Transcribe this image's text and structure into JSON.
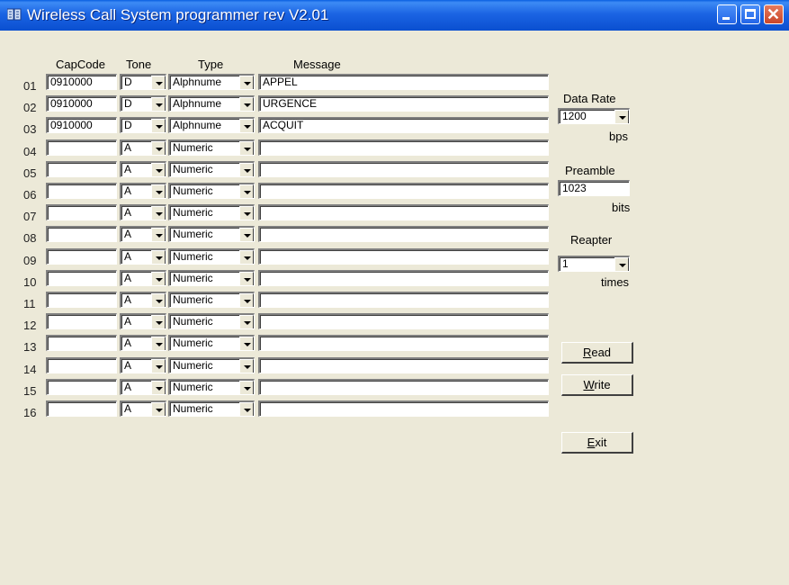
{
  "window": {
    "title": "Wireless Call System programmer rev  V2.01",
    "accent": "#1b64e3",
    "background": "#ece9d8"
  },
  "headers": {
    "capcode": "CapCode",
    "tone": "Tone",
    "type": "Type",
    "message": "Message"
  },
  "rows": [
    {
      "num": "01",
      "capcode": "0910000",
      "tone": "D",
      "type": "Alphnume",
      "message": "APPEL"
    },
    {
      "num": "02",
      "capcode": "0910000",
      "tone": "D",
      "type": "Alphnume",
      "message": "URGENCE"
    },
    {
      "num": "03",
      "capcode": "0910000",
      "tone": "D",
      "type": "Alphnume",
      "message": "ACQUIT"
    },
    {
      "num": "04",
      "capcode": "",
      "tone": "A",
      "type": "Numeric",
      "message": ""
    },
    {
      "num": "05",
      "capcode": "",
      "tone": "A",
      "type": "Numeric",
      "message": ""
    },
    {
      "num": "06",
      "capcode": "",
      "tone": "A",
      "type": "Numeric",
      "message": ""
    },
    {
      "num": "07",
      "capcode": "",
      "tone": "A",
      "type": "Numeric",
      "message": ""
    },
    {
      "num": "08",
      "capcode": "",
      "tone": "A",
      "type": "Numeric",
      "message": ""
    },
    {
      "num": "09",
      "capcode": "",
      "tone": "A",
      "type": "Numeric",
      "message": ""
    },
    {
      "num": "10",
      "capcode": "",
      "tone": "A",
      "type": "Numeric",
      "message": ""
    },
    {
      "num": "11",
      "capcode": "",
      "tone": "A",
      "type": "Numeric",
      "message": ""
    },
    {
      "num": "12",
      "capcode": "",
      "tone": "A",
      "type": "Numeric",
      "message": ""
    },
    {
      "num": "13",
      "capcode": "",
      "tone": "A",
      "type": "Numeric",
      "message": ""
    },
    {
      "num": "14",
      "capcode": "",
      "tone": "A",
      "type": "Numeric",
      "message": ""
    },
    {
      "num": "15",
      "capcode": "",
      "tone": "A",
      "type": "Numeric",
      "message": ""
    },
    {
      "num": "16",
      "capcode": "",
      "tone": "A",
      "type": "Numeric",
      "message": ""
    }
  ],
  "settings": {
    "data_rate_label": "Data Rate",
    "data_rate_value": "1200",
    "data_rate_unit": "bps",
    "preamble_label": "Preamble",
    "preamble_value": "1023",
    "preamble_unit": "bits",
    "repeater_label": "Reapter",
    "repeater_value": "1",
    "repeater_unit": "times"
  },
  "buttons": {
    "read_accel": "R",
    "read_rest": "ead",
    "write_accel": "W",
    "write_rest": "rite",
    "exit_accel": "E",
    "exit_rest": "xit"
  }
}
